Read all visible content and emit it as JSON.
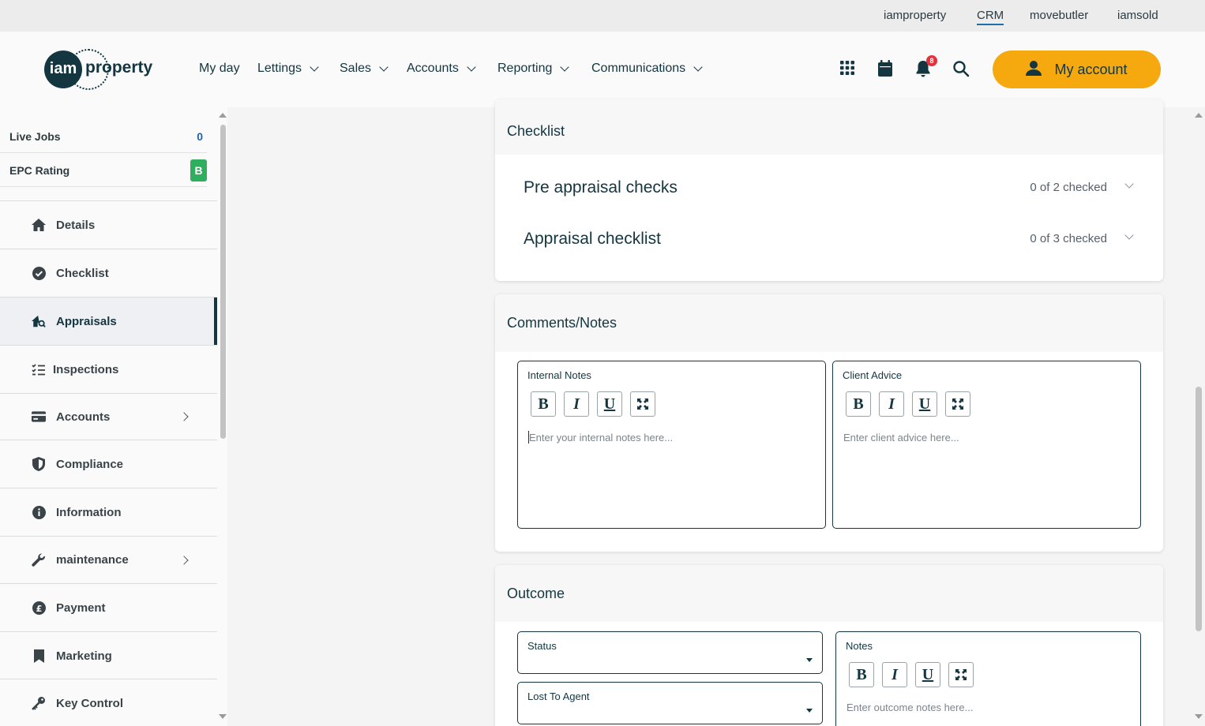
{
  "top_links": [
    "iamproperty",
    "CRM",
    "movebutler",
    "iamsold"
  ],
  "active_top_link": "CRM",
  "logo": {
    "mark": "iam",
    "word": "property"
  },
  "nav": [
    "My day",
    "Lettings",
    "Sales",
    "Accounts",
    "Reporting",
    "Communications"
  ],
  "header_icons": [
    "apps-grid-icon",
    "calendar-icon",
    "bell-icon",
    "search-icon"
  ],
  "notification_count": "8",
  "account_button": "My account",
  "sidebar": {
    "stats": [
      {
        "label": "Live Jobs",
        "value": "0"
      },
      {
        "label": "EPC Rating",
        "value": "B"
      }
    ],
    "items": [
      {
        "label": "Details",
        "icon": "home-icon"
      },
      {
        "label": "Checklist",
        "icon": "check-circle-icon"
      },
      {
        "label": "Appraisals",
        "icon": "house-search-icon",
        "active": true
      },
      {
        "label": "Inspections",
        "icon": "list-check-icon"
      },
      {
        "label": "Accounts",
        "icon": "credit-card-icon",
        "has_submenu": true
      },
      {
        "label": "Compliance",
        "icon": "shield-icon"
      },
      {
        "label": "Information",
        "icon": "info-icon"
      },
      {
        "label": "maintenance",
        "icon": "wrench-icon",
        "has_submenu": true
      },
      {
        "label": "Payment",
        "icon": "pound-icon"
      },
      {
        "label": "Marketing",
        "icon": "bookmark-icon"
      },
      {
        "label": "Key Control",
        "icon": "key-icon"
      }
    ]
  },
  "checklist": {
    "title": "Checklist",
    "rows": [
      {
        "title": "Pre appraisal checks",
        "count": "0 of 2 checked"
      },
      {
        "title": "Appraisal checklist",
        "count": "0 of 3 checked"
      }
    ]
  },
  "comments": {
    "title": "Comments/Notes",
    "internal": {
      "label": "Internal Notes",
      "placeholder": "Enter your internal notes here..."
    },
    "client": {
      "label": "Client Advice",
      "placeholder": "Enter client advice here..."
    }
  },
  "toolbar": {
    "bold": "B",
    "italic": "I",
    "underline": "U"
  },
  "outcome": {
    "title": "Outcome",
    "status_label": "Status",
    "lost_to_agent_label": "Lost To Agent",
    "notes": {
      "label": "Notes",
      "placeholder": "Enter outcome notes here..."
    }
  },
  "colors": {
    "brand_dark": "#133640",
    "accent_orange": "#f6a90f",
    "epc_green": "#2fae5d",
    "stat_blue": "#1b62b5",
    "notification_red": "#e4323c"
  }
}
